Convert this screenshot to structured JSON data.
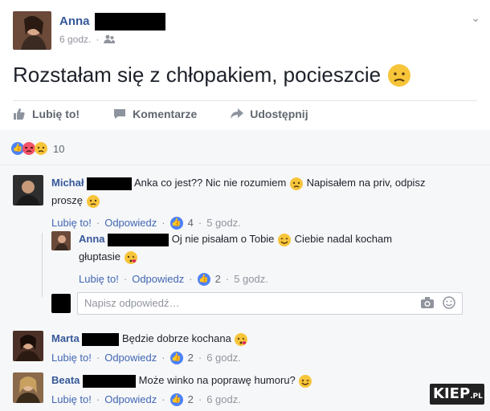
{
  "post": {
    "author": "Anna",
    "time": "6 godz.",
    "text": "Rozstałam się z chłopakiem, pocieszcie",
    "actions": {
      "like": "Lubię to!",
      "comment": "Komentarze",
      "share": "Udostępnij"
    },
    "reactions_count": "10"
  },
  "comments": [
    {
      "name": "Michał",
      "text1": "Anka co jest?? Nic nie rozumiem",
      "text2": "Napisałem na priv, odpisz",
      "text3": "proszę",
      "like": "Lubię to!",
      "reply": "Odpowiedz",
      "likes": "4",
      "time": "5 godz."
    },
    {
      "name": "Anna",
      "text1": "Oj nie pisałam o Tobie",
      "text2": "Ciebie nadal kocham",
      "text3": "głuptasie",
      "like": "Lubię to!",
      "reply": "Odpowiedz",
      "likes": "2",
      "time": "5 godz."
    },
    {
      "name": "Marta",
      "text1": "Będzie dobrze kochana",
      "like": "Lubię to!",
      "reply": "Odpowiedz",
      "likes": "2",
      "time": "6 godz."
    },
    {
      "name": "Beata",
      "text1": "Może winko na poprawę humoru?",
      "like": "Lubię to!",
      "reply": "Odpowiedz",
      "likes": "2",
      "time": "6 godz."
    }
  ],
  "reply_placeholder": "Napisz odpowiedź…",
  "watermark": {
    "main": "KIEP",
    "suffix": ".PL"
  },
  "colors": {
    "name": "#365899",
    "link": "#4267b2",
    "muted": "#90949c",
    "background": "#f6f7f9"
  },
  "icons": [
    "thumbs-up-icon",
    "comment-icon",
    "share-arrow-icon",
    "globe-friends-icon",
    "camera-icon",
    "smiley-icon",
    "chevron-down-icon"
  ]
}
